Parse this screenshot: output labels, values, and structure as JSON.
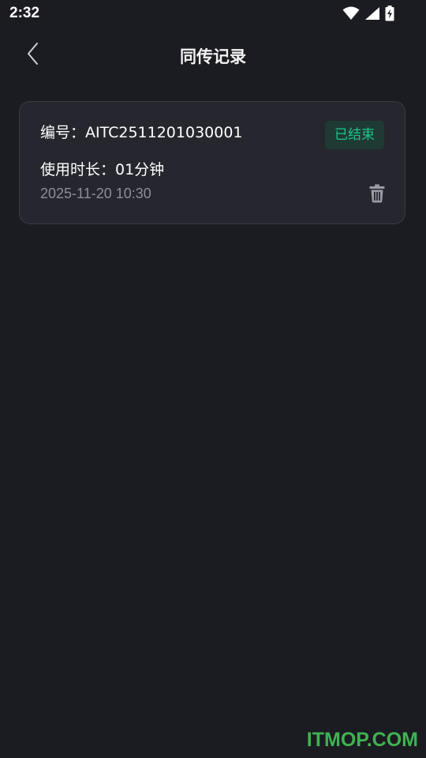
{
  "status_bar": {
    "time": "2:32",
    "icons": [
      "wifi-icon",
      "signal-icon",
      "battery-charging-icon"
    ]
  },
  "header": {
    "back_icon": "chevron-left-icon",
    "title": "同传记录"
  },
  "records": [
    {
      "number_label": "编号：AITC2511201030001",
      "status": "已结束",
      "duration_label": "使用时长：01分钟",
      "datetime": "2025-11-20 10:30",
      "delete_icon": "trash-icon"
    }
  ],
  "colors": {
    "background": "#1b1b22",
    "card": "#26272e",
    "status_text": "#1fc48a",
    "status_bg": "#1f3a34",
    "muted_text": "#8d8e96"
  },
  "watermark": "ITMOP.COM"
}
